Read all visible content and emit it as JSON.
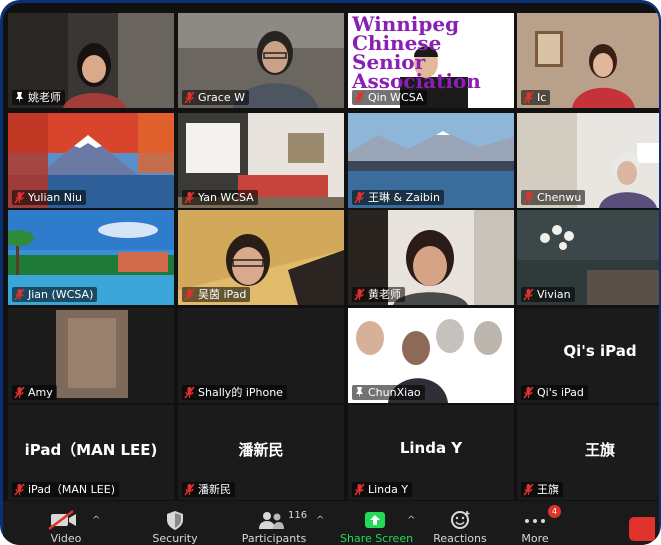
{
  "tiles": [
    {
      "name": "姚老师",
      "icon": "pin-icon",
      "active": true,
      "scene": "woman-dark-room"
    },
    {
      "name": "Grace W",
      "icon": "mic-muted-icon",
      "scene": "woman-glasses-room"
    },
    {
      "name": "Qin WCSA",
      "icon": "mic-muted-icon",
      "scene": "wcsa-banner",
      "overlay": [
        "Winnipeg",
        "Chinese",
        "Senior",
        "Association"
      ]
    },
    {
      "name": "Ic",
      "icon": "mic-muted-icon",
      "scene": "woman-red-room"
    },
    {
      "name": "Yulian Niu",
      "icon": "mic-muted-icon",
      "scene": "mt-fuji-autumn"
    },
    {
      "name": "Yan WCSA",
      "icon": "mic-muted-icon",
      "scene": "living-room"
    },
    {
      "name": "王琳 & Zaibin",
      "icon": "mic-muted-icon",
      "scene": "harbour-mountains"
    },
    {
      "name": "Chenwu",
      "icon": "mic-muted-icon",
      "scene": "old-woman-white-room"
    },
    {
      "name": "Jian (WCSA)",
      "icon": "mic-muted-icon",
      "scene": "tropical-resort"
    },
    {
      "name": "吴茵 iPad",
      "icon": "mic-muted-icon",
      "scene": "woman-ceiling"
    },
    {
      "name": "黄老师",
      "icon": "mic-muted-icon",
      "scene": "woman-closeup"
    },
    {
      "name": "Vivian",
      "icon": "mic-muted-icon",
      "scene": "dark-dining-room"
    },
    {
      "name": "Amy",
      "icon": "mic-muted-icon",
      "scene": "blurred-video"
    },
    {
      "name": "Shally的 iPhone",
      "icon": "mic-muted-icon",
      "scene": "empty"
    },
    {
      "name": "ChunXiao",
      "icon": "pin-icon",
      "scene": "man-portraits"
    },
    {
      "name": "Qi's iPad",
      "icon": "mic-muted-icon",
      "scene": "empty",
      "bigname": "Qi's iPad"
    },
    {
      "name": "iPad（MAN  LEE)",
      "icon": "mic-muted-icon",
      "scene": "empty",
      "bigname": "iPad（MAN  LEE)"
    },
    {
      "name": "潘新民",
      "icon": "mic-muted-icon",
      "scene": "empty",
      "bigname": "潘新民"
    },
    {
      "name": "Linda Y",
      "icon": "mic-muted-icon",
      "scene": "empty",
      "bigname": "Linda Y"
    },
    {
      "name": "王旗",
      "icon": "mic-muted-icon",
      "scene": "empty",
      "bigname": "王旗"
    }
  ],
  "toolbar": {
    "video": {
      "label": "Video",
      "icon": "video-off-icon"
    },
    "security": {
      "label": "Security",
      "icon": "shield-icon"
    },
    "participants": {
      "label": "Participants",
      "icon": "participants-icon",
      "count": "116"
    },
    "share": {
      "label": "Share Screen",
      "icon": "share-screen-icon",
      "color": "#23d959"
    },
    "reactions": {
      "label": "Reactions",
      "icon": "smile-plus-icon"
    },
    "more": {
      "label": "More",
      "icon": "more-icon",
      "badge": "4"
    }
  }
}
